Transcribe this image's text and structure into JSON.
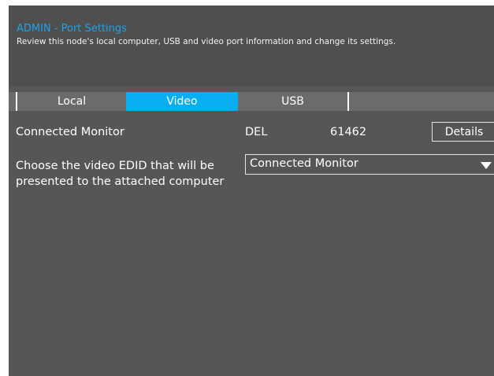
{
  "header": {
    "title": "ADMIN - Port Settings",
    "subtitle": "Review this node's local computer, USB and video port information and change its settings."
  },
  "tabs": [
    {
      "label": "Local",
      "active": false
    },
    {
      "label": "Video",
      "active": true
    },
    {
      "label": "USB",
      "active": false
    }
  ],
  "monitor": {
    "label": "Connected Monitor",
    "vendor": "DEL",
    "id": "61462",
    "details_label": "Details"
  },
  "edid": {
    "label": "Choose the video EDID that will be presented to the attached computer",
    "selected": "Connected Monitor"
  },
  "colors": {
    "accent": "#09aef0",
    "title": "#1aa3e8",
    "background": "#565656"
  }
}
